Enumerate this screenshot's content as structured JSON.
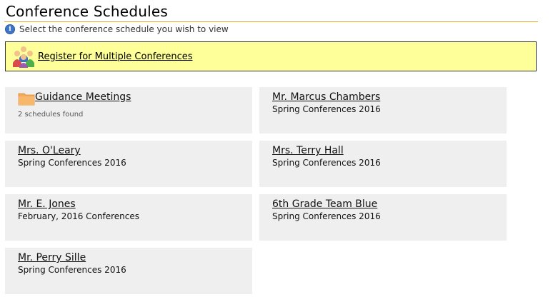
{
  "page": {
    "title": "Conference Schedules",
    "info_text": "Select the conference schedule you wish to view",
    "register_label": "Register for Multiple Conferences"
  },
  "schedules": [
    {
      "title": "Guidance Meetings",
      "subtitle": "2 schedules found",
      "icon": "folder-icon"
    },
    {
      "title": "Mr. Marcus Chambers",
      "subtitle": "Spring Conferences 2016"
    },
    {
      "title": "Mrs. O'Leary",
      "subtitle": "Spring Conferences 2016"
    },
    {
      "title": "Mrs. Terry Hall",
      "subtitle": "Spring Conferences 2016"
    },
    {
      "title": "Mr. E. Jones",
      "subtitle": "February, 2016 Conferences"
    },
    {
      "title": "6th Grade Team Blue",
      "subtitle": "Spring Conferences 2016"
    },
    {
      "title": "Mr. Perry Sille",
      "subtitle": "Spring Conferences 2016"
    }
  ],
  "colors": {
    "accent_rule": "#e3a72f",
    "register_bg": "#ffff99",
    "card_bg": "#efefef",
    "folder": "#f4a95a"
  }
}
